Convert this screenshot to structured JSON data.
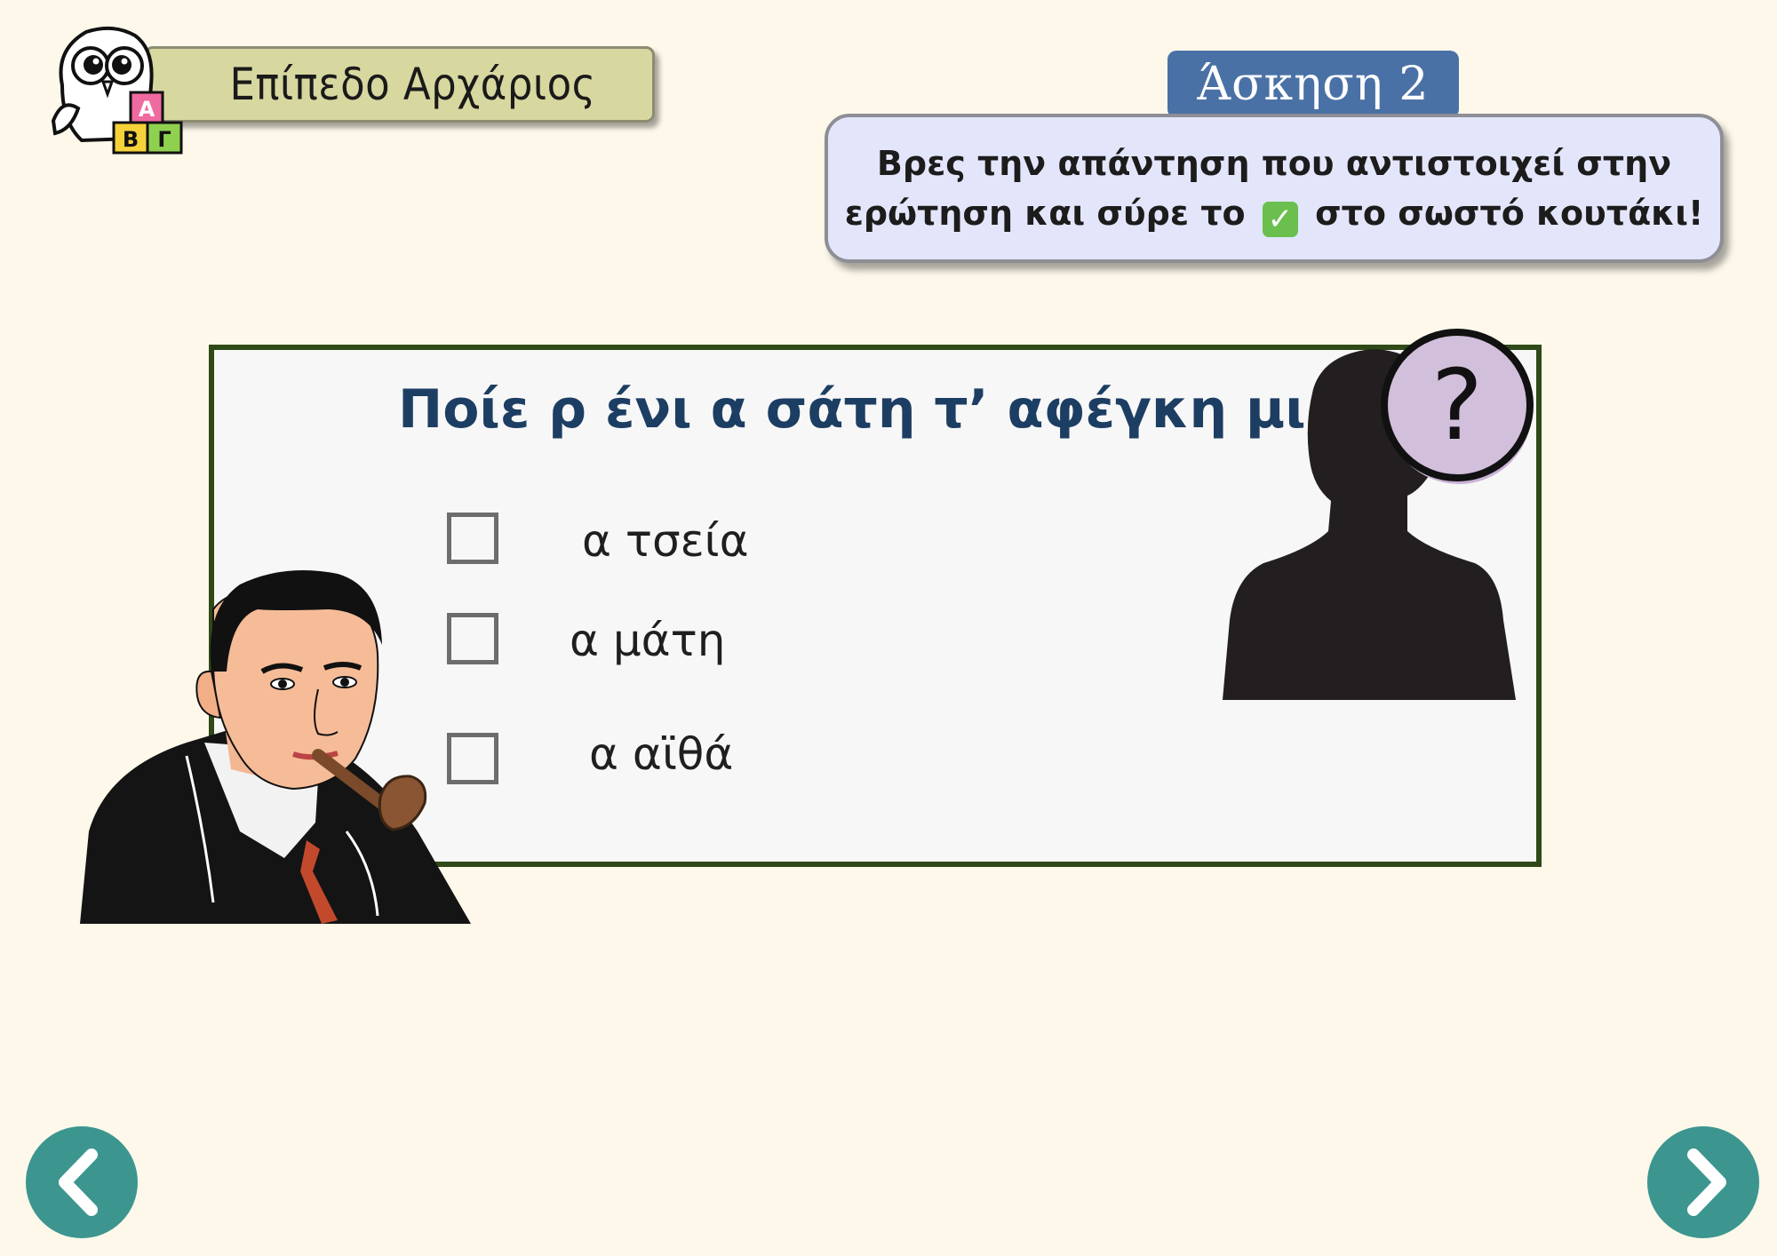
{
  "level": {
    "label": "Επίπεδο Αρχάριος",
    "owl_icon": "owl-abc-blocks-icon",
    "blocks": [
      "Α",
      "Β",
      "Γ"
    ]
  },
  "exercise": {
    "label": "Άσκηση 2"
  },
  "instruction": {
    "line1": "Βρες την απάντηση που αντιστοιχεί στην",
    "line2_before": "ερώτηση και σύρε το",
    "check_symbol": "✓",
    "line2_after": "στο σωστό κουτάκι!"
  },
  "question": {
    "title": "Ποίε ρ ένι α σάτη τ’ αφέγκη μι;",
    "answers": [
      {
        "label": "α τσεία"
      },
      {
        "label": "α μάτη"
      },
      {
        "label": "α αϊθά"
      }
    ],
    "question_mark": "?"
  },
  "navigation": {
    "prev_icon": "chevron-left-icon",
    "next_icon": "chevron-right-icon"
  },
  "colors": {
    "background": "#fdf8ea",
    "card_border": "#2f4a18",
    "title": "#1d3e63",
    "exercise_tag": "#4a71a6",
    "nav": "#3c968f",
    "instruction_bg": "#e3e6fb",
    "level_banner": "#d7d7a0"
  }
}
